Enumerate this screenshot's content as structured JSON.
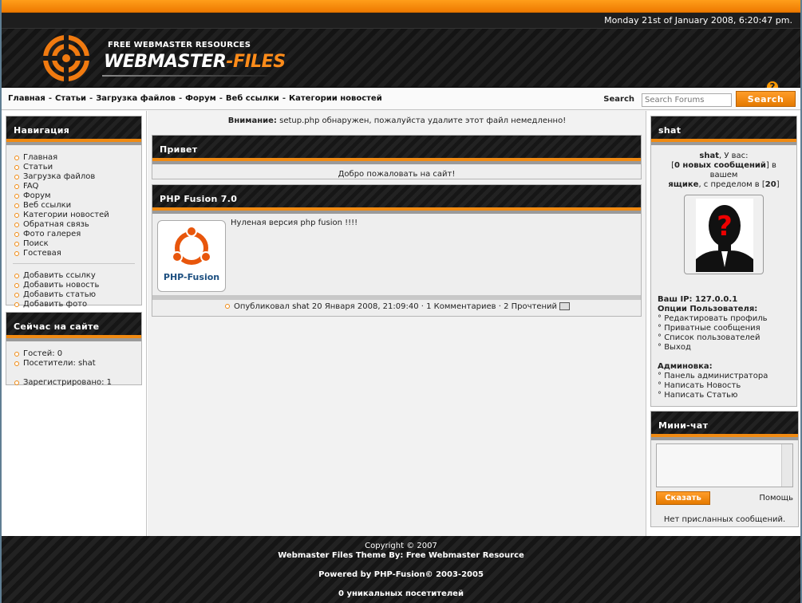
{
  "datetime": "Monday 21st of January 2008, 6:20:47 pm.",
  "logo": {
    "small": "FREE WEBMASTER RESOURCES",
    "big_main": "WEBMASTER",
    "big_accent": "-FILES"
  },
  "nav": {
    "links": [
      "Главная",
      "Статьи",
      "Загрузка файлов",
      "Форум",
      "Веб ссылки",
      "Категории новостей"
    ],
    "separator": "-"
  },
  "search": {
    "label": "Search",
    "placeholder": "Search Forums",
    "button": "Search"
  },
  "navigation_panel": {
    "title": "Навигация",
    "items": [
      "Главная",
      "Статьи",
      "Загрузка файлов",
      "FAQ",
      "Форум",
      "Веб ссылки",
      "Категории новостей",
      "Обратная связь",
      "Фото галерея",
      "Поиск",
      "Гостевая"
    ],
    "items2": [
      "Добавить ссылку",
      "Добавить новость",
      "Добавить статью",
      "Добавить фото"
    ]
  },
  "online_panel": {
    "title": "Сейчас на сайте",
    "guests": "Гостей: 0",
    "visitors": "Посетители: shat",
    "registered": "Зарегистрировано: 1"
  },
  "warning": {
    "label": "Внимание:",
    "text": " setup.php обнаружен, пожалуйста удалите этот файл немедленно!"
  },
  "hello_panel": {
    "title": "Привет",
    "text": "Добро пожаловать на сайт!"
  },
  "news": {
    "title": "PHP Fusion 7.0",
    "text": "Нуленая версия php fusion !!!!",
    "image_label": "PHP-Fusion",
    "meta_prefix": "Опубликовал ",
    "author": "shat",
    "date": " 20 Января 2008, 21:09:40 · ",
    "comments": "1 Комментариев",
    "sep": " · ",
    "reads": "2 Прочтений"
  },
  "user_panel": {
    "title": "shat",
    "line1_user": "shat",
    "line1_rest": ", У вас:",
    "line2_open": "[",
    "line2_bold": "0 новых сообщений",
    "line2_close": "] в",
    "line3": "вашем",
    "line4_bold": "ящике",
    "line4_rest": ", с пределом в [",
    "line4_num": "20",
    "line4_close": "]",
    "ip": "Ваш IP: 127.0.0.1",
    "options_title": "Опции Пользователя:",
    "options": [
      "Редактировать профиль",
      "Приватные сообщения",
      "Список пользователей",
      "Выход"
    ],
    "admin_title": "Админовка:",
    "admin": [
      "Панель администратора",
      "Написать Новость",
      "Написать Статью"
    ]
  },
  "minichat": {
    "title": "Мини-чат",
    "button": "Сказать",
    "help": "Помощь",
    "empty": "Нет присланных сообщений."
  },
  "footer": {
    "copyright": "Copyright © 2007",
    "theme": "Webmaster Files Theme By: Free Webmaster Resource",
    "powered": "Powered by PHP-Fusion© 2003-2005",
    "visitors": "0 уникальных посетителей"
  },
  "colors": {
    "accent": "#f08a12",
    "dark": "#1a1a1a",
    "page_bg": "#5f7e93"
  }
}
